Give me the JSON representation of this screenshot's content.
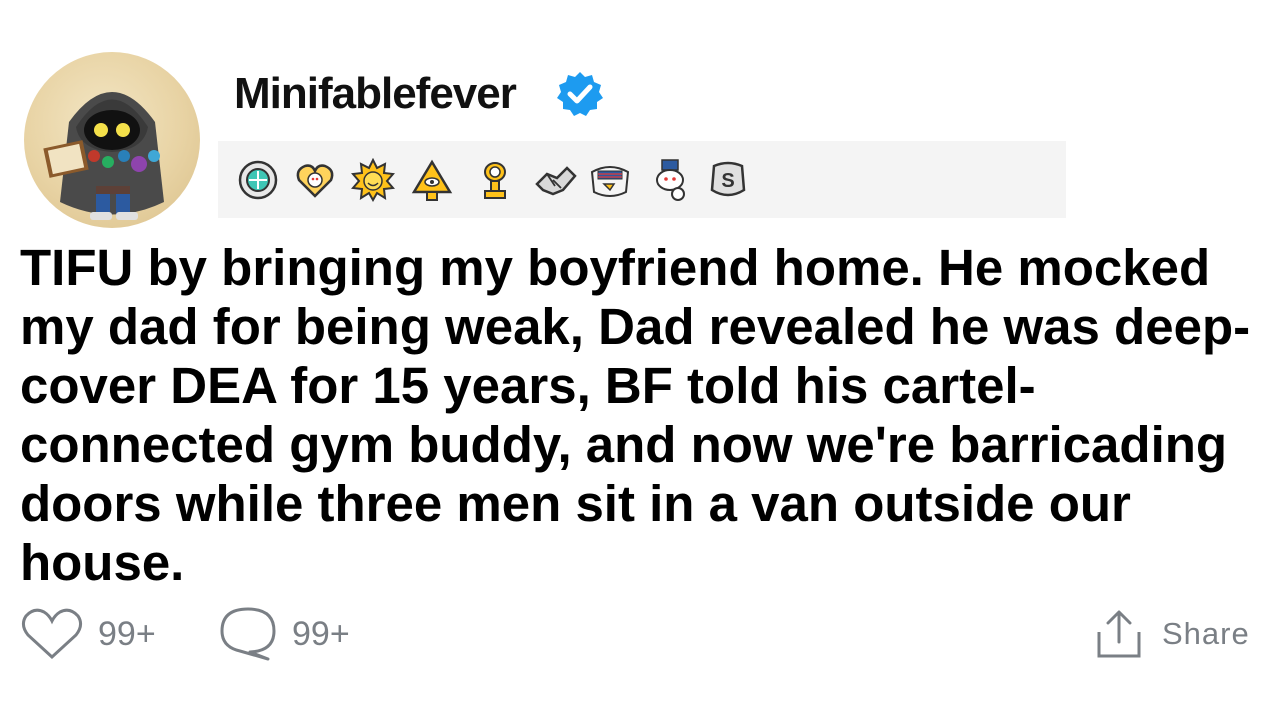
{
  "post": {
    "username": "Minifablefever",
    "verified": true,
    "title": "TIFU by bringing my boyfriend home. He mocked my dad for being weak, Dad revealed he was deep-cover DEA for 15 years, BF told his cartel-connected gym buddy, and now we're barricading doors while three men sit in a van outside our house."
  },
  "awards": [
    "gem-award-icon",
    "wholesome-heart-award-icon",
    "sun-award-icon",
    "illuminati-award-icon",
    "gold-trophy-award-icon",
    "handshake-award-icon",
    "eagle-award-icon",
    "pointing-snoo-award-icon",
    "silver-award-icon"
  ],
  "actions": {
    "likes": "99+",
    "comments": "99+",
    "share_label": "Share"
  },
  "colors": {
    "text": "#000000",
    "muted": "#7a7f85",
    "verified_blue": "#1d9bf0",
    "award_strip_bg": "#f4f4f4"
  }
}
